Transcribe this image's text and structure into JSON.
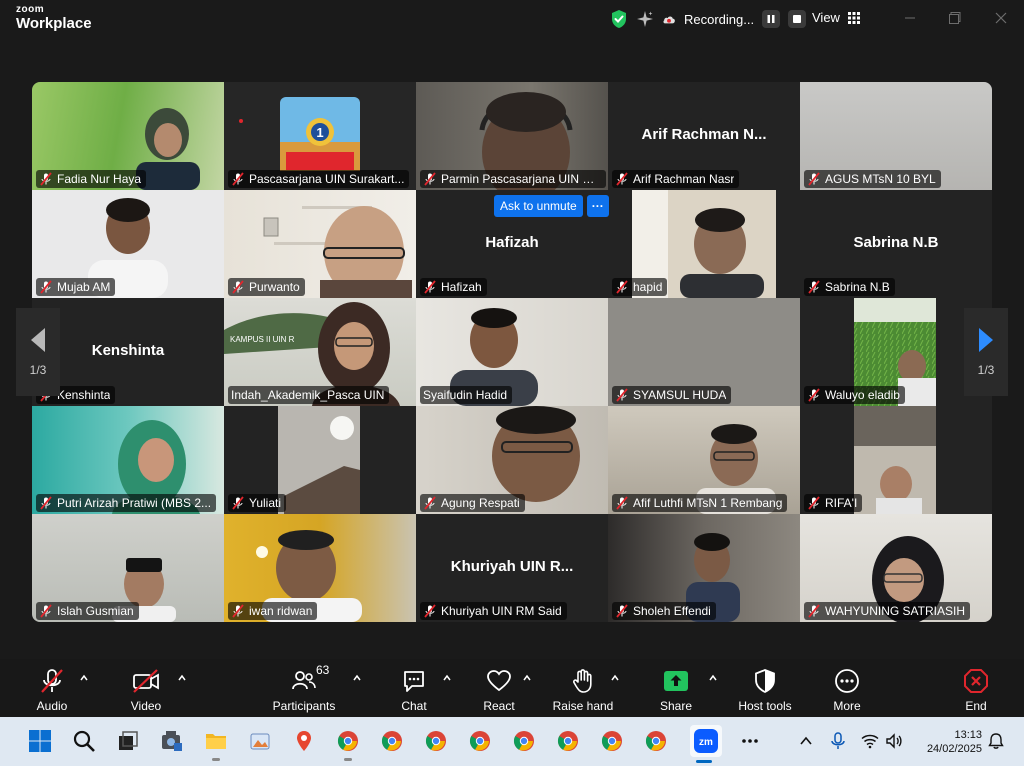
{
  "app": {
    "brand_top": "zoom",
    "brand_bottom": "Workplace"
  },
  "titlebar": {
    "recording_label": "Recording...",
    "view_label": "View"
  },
  "participants_tiles": [
    {
      "name": "Fadia Nur Haya",
      "center_name": ""
    },
    {
      "name": "Pascasarjana UIN Surakart...",
      "center_name": ""
    },
    {
      "name": "Parmin Pascasarjana UIN R...",
      "center_name": ""
    },
    {
      "name": "Arif Rachman Nasr",
      "center_name": "Arif Rachman N..."
    },
    {
      "name": "AGUS MTsN 10 BYL",
      "center_name": ""
    },
    {
      "name": "Mujab AM",
      "center_name": ""
    },
    {
      "name": "Purwanto",
      "center_name": ""
    },
    {
      "name": "Hafizah",
      "center_name": "Hafizah"
    },
    {
      "name": "hapid",
      "center_name": ""
    },
    {
      "name": "Sabrina N.B",
      "center_name": "Sabrina N.B"
    },
    {
      "name": "Kenshinta",
      "center_name": "Kenshinta"
    },
    {
      "name": "Indah_Akademik_Pasca UIN",
      "center_name": ""
    },
    {
      "name": "Syaifudin Hadid",
      "center_name": ""
    },
    {
      "name": "SYAMSUL HUDA",
      "center_name": ""
    },
    {
      "name": "Waluyo eladib",
      "center_name": ""
    },
    {
      "name": "Putri Arizah Pratiwi (MBS 2...",
      "center_name": ""
    },
    {
      "name": "Yuliati",
      "center_name": ""
    },
    {
      "name": "Agung Respati",
      "center_name": ""
    },
    {
      "name": "Afif Luthfi MTsN 1 Rembang",
      "center_name": ""
    },
    {
      "name": "RIFA'I",
      "center_name": ""
    },
    {
      "name": "Islah Gusmian",
      "center_name": ""
    },
    {
      "name": "iwan ridwan",
      "center_name": ""
    },
    {
      "name": "Khuriyah UIN RM Said",
      "center_name": "Khuriyah UIN R..."
    },
    {
      "name": "Sholeh Effendi",
      "center_name": ""
    },
    {
      "name": "WAHYUNING SATRIASIH",
      "center_name": ""
    }
  ],
  "video_overlay": {
    "tile_text": "KAMPUS II UIN R"
  },
  "unmute": {
    "button_label": "Ask to unmute",
    "more_label": "···"
  },
  "pager": {
    "left_page": "1/3",
    "right_page": "1/3"
  },
  "toolbar": {
    "audio": "Audio",
    "video": "Video",
    "participants": "Participants",
    "participants_count": "63",
    "chat": "Chat",
    "react": "React",
    "raise_hand": "Raise hand",
    "share": "Share",
    "host_tools": "Host tools",
    "more": "More",
    "end": "End"
  },
  "colors": {
    "active_speaker": "#2fd35b",
    "accent_blue": "#0e72ed",
    "share_green": "#22c35e",
    "end_red": "#e0262d",
    "mute_red": "#e0262d"
  },
  "taskbar": {
    "time": "13:13",
    "date": "24/02/2025",
    "zoom_badge": "zm"
  }
}
